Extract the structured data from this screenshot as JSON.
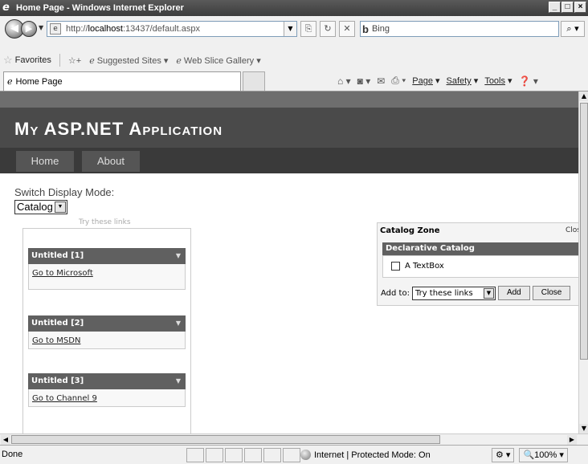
{
  "window": {
    "title": "Home Page - Windows Internet Explorer",
    "controls": [
      "_",
      "□",
      "×"
    ]
  },
  "address": {
    "url_prefix": "http://",
    "url_host": "localhost",
    "url_rest": ":13437/default.aspx",
    "search_placeholder": "Bing"
  },
  "favorites": {
    "label": "Favorites",
    "items": [
      "Suggested Sites ▾",
      "Web Slice Gallery ▾"
    ]
  },
  "tab": {
    "label": "Home Page"
  },
  "commands": {
    "page": "Page",
    "safety": "Safety",
    "tools": "Tools"
  },
  "site": {
    "title": "My ASP.NET Application",
    "menu": [
      "Home",
      "About"
    ],
    "switch_label": "Switch Display Mode:",
    "mode_selected": "Catalog"
  },
  "webzone": {
    "title": "Try these links",
    "parts": [
      {
        "title": "Untitled [1]",
        "link": "Go to Microsoft"
      },
      {
        "title": "Untitled [2]",
        "link": "Go to MSDN"
      },
      {
        "title": "Untitled [3]",
        "link": "Go to Channel 9"
      }
    ]
  },
  "catalog": {
    "title": "Catalog Zone",
    "close": "Clos",
    "declarative_title": "Declarative Catalog",
    "item_label": "A TextBox",
    "add_to_label": "Add to:",
    "add_to_selected": "Try these links",
    "add_button": "Add",
    "close_button": "Close"
  },
  "status": {
    "text": "Done",
    "zone": "Internet | Protected Mode: On",
    "zoom": "100%"
  }
}
